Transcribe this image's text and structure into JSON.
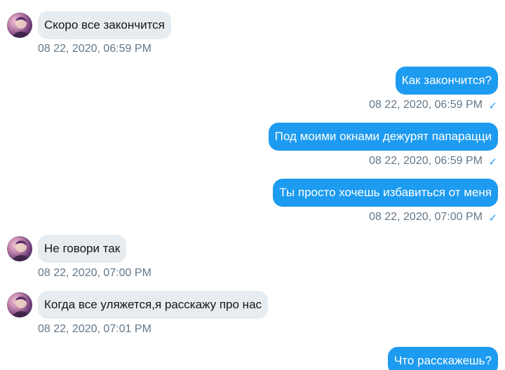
{
  "colors": {
    "outgoing_bubble": "#1d9bf0",
    "incoming_bubble": "#e6ecf0",
    "timestamp": "#657786",
    "read_check": "#1d9bf0"
  },
  "icons": {
    "avatar": "avatar",
    "read_receipt": "check-icon"
  },
  "messages": [
    {
      "direction": "in",
      "text": "Скоро все закончится",
      "time": "08 22, 2020, 06:59 PM"
    },
    {
      "direction": "out",
      "text": "Как закончится?",
      "time": "08 22, 2020, 06:59 PM",
      "check": "✓"
    },
    {
      "direction": "out",
      "text": "Под моими окнами дежурят папарацци",
      "time": "08 22, 2020, 06:59 PM",
      "check": "✓"
    },
    {
      "direction": "out",
      "text": "Ты просто хочешь избавиться от меня",
      "time": "08 22, 2020, 07:00 PM",
      "check": "✓"
    },
    {
      "direction": "in",
      "text": "Не говори так",
      "time": "08 22, 2020, 07:00 PM"
    },
    {
      "direction": "in",
      "text": "Когда все уляжется,я расскажу про нас",
      "time": "08 22, 2020, 07:01 PM"
    },
    {
      "direction": "out",
      "text": "Что расскажешь?"
    }
  ]
}
